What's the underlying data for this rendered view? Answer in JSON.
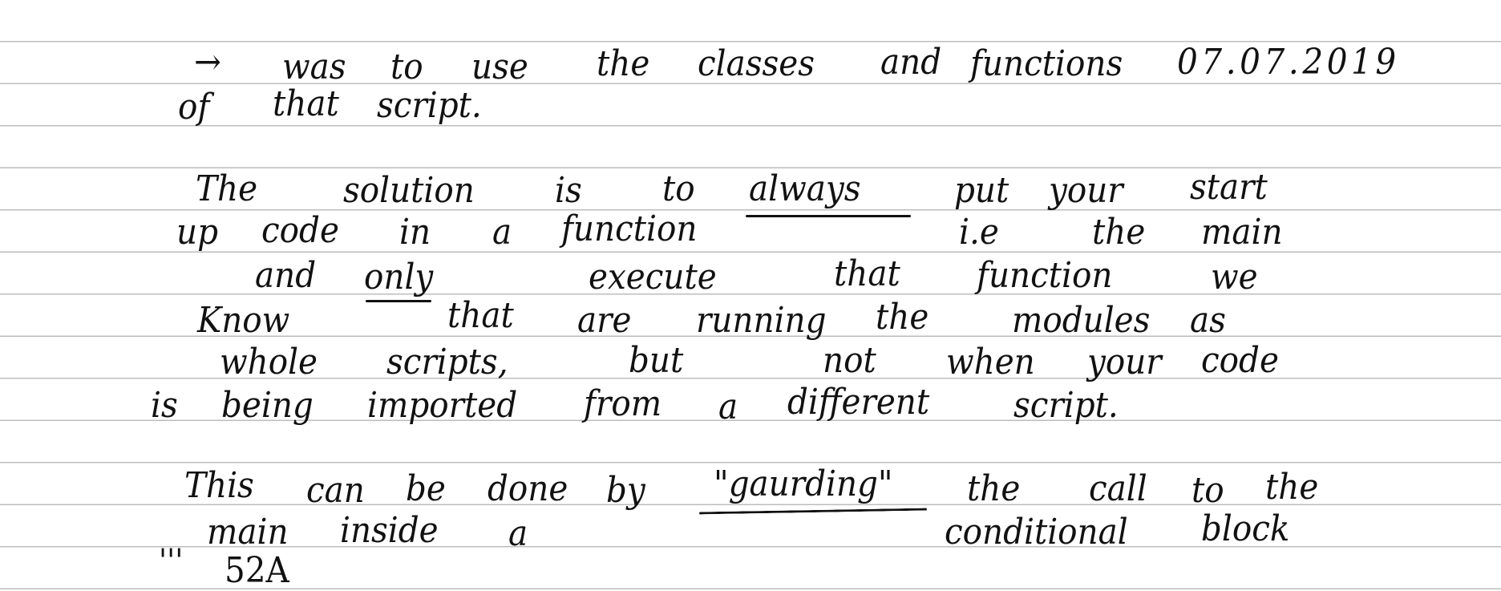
{
  "note": {
    "paragraph_1": {
      "arrow": "→",
      "line1_words": [
        "was",
        "to",
        "use",
        "the",
        "classes",
        "and",
        "functions"
      ],
      "date": "07.07.2019",
      "line2_words": [
        "of",
        "that",
        "script."
      ]
    },
    "paragraph_2": {
      "line1_words": [
        "The",
        "solution",
        "is",
        "to",
        "always",
        "put",
        "your",
        "start"
      ],
      "line2_words": [
        "up",
        "code",
        "in",
        "a",
        "function",
        "i.e",
        "the",
        "main"
      ],
      "line3_words": [
        "and",
        "only",
        "execute",
        "that",
        "function",
        "we"
      ],
      "line4_words": [
        "Know",
        "that",
        "are",
        "running",
        "the",
        "modules",
        "as"
      ],
      "line5_words": [
        "whole",
        "scripts,",
        "but",
        "not",
        "when",
        "your",
        "code"
      ],
      "line6_words": [
        "is",
        "being",
        "imported",
        "from",
        "a",
        "different",
        "script."
      ]
    },
    "paragraph_3": {
      "line1_words": [
        "This",
        "can",
        "be",
        "done",
        "by",
        "\"gaurding\"",
        "the",
        "call",
        "to",
        "the"
      ],
      "line2_words": [
        "main",
        "inside",
        "a",
        "conditional",
        "block"
      ],
      "line3_words": [
        "'''",
        "52A"
      ]
    },
    "colors": {
      "ink": "#111111",
      "rule": "#bdbdbd",
      "paper": "#ffffff"
    }
  }
}
